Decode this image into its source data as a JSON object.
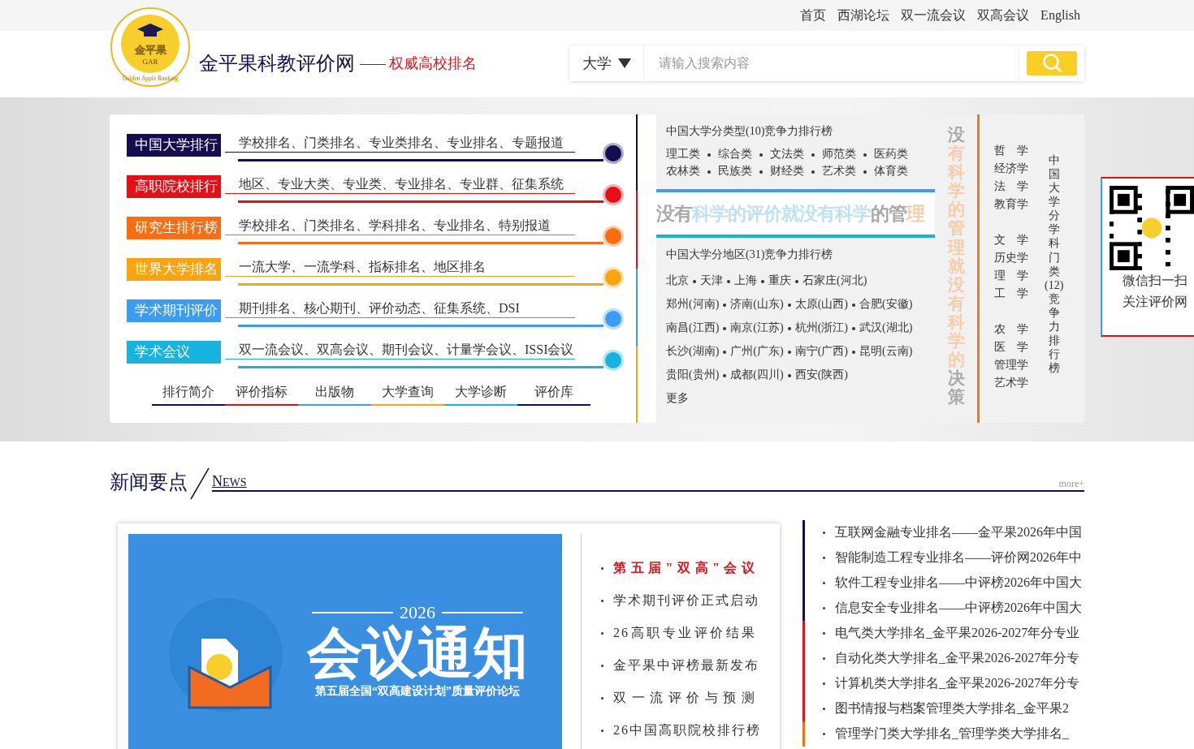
{
  "top_nav": [
    "首页",
    "西湖论坛",
    "双一流会议",
    "双高会议",
    "English"
  ],
  "logo": {
    "name": "金平果",
    "abbr": "GAR",
    "motto": "Golden Apple Ranking"
  },
  "site": {
    "title": "金平果科教评价网",
    "dash": "——",
    "tagline": "权威高校排名"
  },
  "search": {
    "scope": "大学",
    "placeholder": "请输入搜索内容"
  },
  "categories": [
    {
      "label": "中国大学排行",
      "links": "学校排名、门类排名、专业类排名、专业排名、专题报道",
      "color": "#140d4f"
    },
    {
      "label": "高职院校排行",
      "links": "地区、专业大类、专业类、专业排名、专业群、征集系统",
      "color": "#e50f17"
    },
    {
      "label": "研究生排行榜",
      "links": "学校排名、门类排名、学科排名、专业排名、特别报道",
      "color": "#fb6d10"
    },
    {
      "label": "世界大学排名",
      "links": "一流大学、一流学科、指标排名、地区排名",
      "color": "#fba412"
    },
    {
      "label": "学术期刊评价",
      "links": "期刊排名、核心期刊、评价动态、征集系统、DSI",
      "color": "#3a9df3"
    },
    {
      "label": "学术会议",
      "links": "双一流会议、双高会议、期刊会议、计量学会议、ISSI会议",
      "color": "#15b3dd"
    }
  ],
  "bottom_links": [
    {
      "label": "排行简介",
      "color": "#140d4f"
    },
    {
      "label": "评价指标",
      "color": "#e50f17"
    },
    {
      "label": "出版物",
      "color": "#3a9df3"
    },
    {
      "label": "大学查询",
      "color": "#fba412"
    },
    {
      "label": "大学诊断",
      "color": "#15b3dd"
    },
    {
      "label": "评价库",
      "color": "#140d4f"
    }
  ],
  "type_panel": {
    "title": "中国大学分类型(10)竞争力排行榜",
    "lines": [
      {
        "types": [
          "理工类",
          "综合类",
          "文法类",
          "师范类",
          "医药类"
        ]
      },
      {
        "types": [
          "农林类",
          "民族类",
          "财经类",
          "艺术类",
          "体育类"
        ]
      }
    ]
  },
  "slogan": [
    {
      "text": "没有",
      "color": "#a9a9a9"
    },
    {
      "text": "科学的评价就没有科学",
      "color": "#bfe2f2"
    },
    {
      "text": "的管",
      "color": "#a9a9a9"
    },
    {
      "text": "理",
      "color": "#f9cba9"
    }
  ],
  "vertical_slogan": [
    {
      "text": "没",
      "color": "#a9a9a9"
    },
    {
      "text": "有科学的管理就没有科学的",
      "color": "#f9cba9"
    },
    {
      "text": "决策",
      "color": "#a9a9a9"
    }
  ],
  "region_panel": {
    "title": "中国大学分地区(31)竞争力排行榜",
    "lines": [
      {
        "cities": [
          "北京",
          "天津",
          "上海",
          "重庆",
          "石家庄(河北)"
        ]
      },
      {
        "cities": [
          "郑州(河南)",
          "济南(山东)",
          "太原(山西)",
          "合肥(安徽)"
        ]
      },
      {
        "cities": [
          "南昌(江西)",
          "南京(江苏)",
          "杭州(浙江)",
          "武汉(湖北)"
        ]
      },
      {
        "cities": [
          "长沙(湖南)",
          "广州(广东)",
          "南宁(广西)",
          "昆明(云南)"
        ]
      },
      {
        "cities": [
          "贵阳(贵州)",
          "成都(四川)",
          "西安(陕西)"
        ]
      }
    ],
    "more": "更多"
  },
  "disciplines": {
    "groups": [
      [
        "哲　学",
        "经济学",
        "法　学",
        "教育学"
      ],
      [
        "文　学",
        "历史学",
        "理　学",
        "工　学"
      ],
      [
        "农　学",
        "医　学",
        "管理学",
        "艺术学"
      ]
    ],
    "title": "中国大学分学科门类(12)竞争力排行榜"
  },
  "qr": {
    "caption": [
      "微信扫一扫",
      "关注评价网"
    ]
  },
  "news": {
    "heading": "新闻要点",
    "heading_en": "NEWS",
    "more": "more+"
  },
  "banner": {
    "year": "2026",
    "title": "会议通知",
    "subtitle": "第五届全国“双高建设计划”质量评价论坛"
  },
  "highlights": [
    {
      "text": "第五届\"双高\"会议",
      "selected": true
    },
    {
      "text": "学术期刊评价正式启动",
      "selected": false
    },
    {
      "text": "26高职专业评价结果",
      "selected": false
    },
    {
      "text": "金平果中评榜最新发布",
      "selected": false
    },
    {
      "text": "双一流评价与预测",
      "selected": false
    },
    {
      "text": "26中国高职院校排行榜",
      "selected": false
    }
  ],
  "news_list": [
    {
      "text": "互联网金融专业排名——金平果2026年中国",
      "color": "#140d4f"
    },
    {
      "text": "智能制造工程专业排名——评价网2026年中",
      "color": "#140d4f"
    },
    {
      "text": "软件工程专业排名——中评榜2026年中国大",
      "color": "#140d4f"
    },
    {
      "text": "信息安全专业排名——中评榜2026年中国大",
      "color": "#140d4f"
    },
    {
      "text": "电气类大学排名_金平果2026-2027年分专业",
      "color": "#e50f17"
    },
    {
      "text": "自动化类大学排名_金平果2026-2027年分专",
      "color": "#e50f17"
    },
    {
      "text": "计算机类大学排名_金平果2026-2027年分专",
      "color": "#e50f17"
    },
    {
      "text": "图书情报与档案管理类大学排名_金平果2",
      "color": "#e50f17"
    },
    {
      "text": "管理学门类大学排名_管理学类大学排名_",
      "color": "#fb6d10"
    }
  ]
}
